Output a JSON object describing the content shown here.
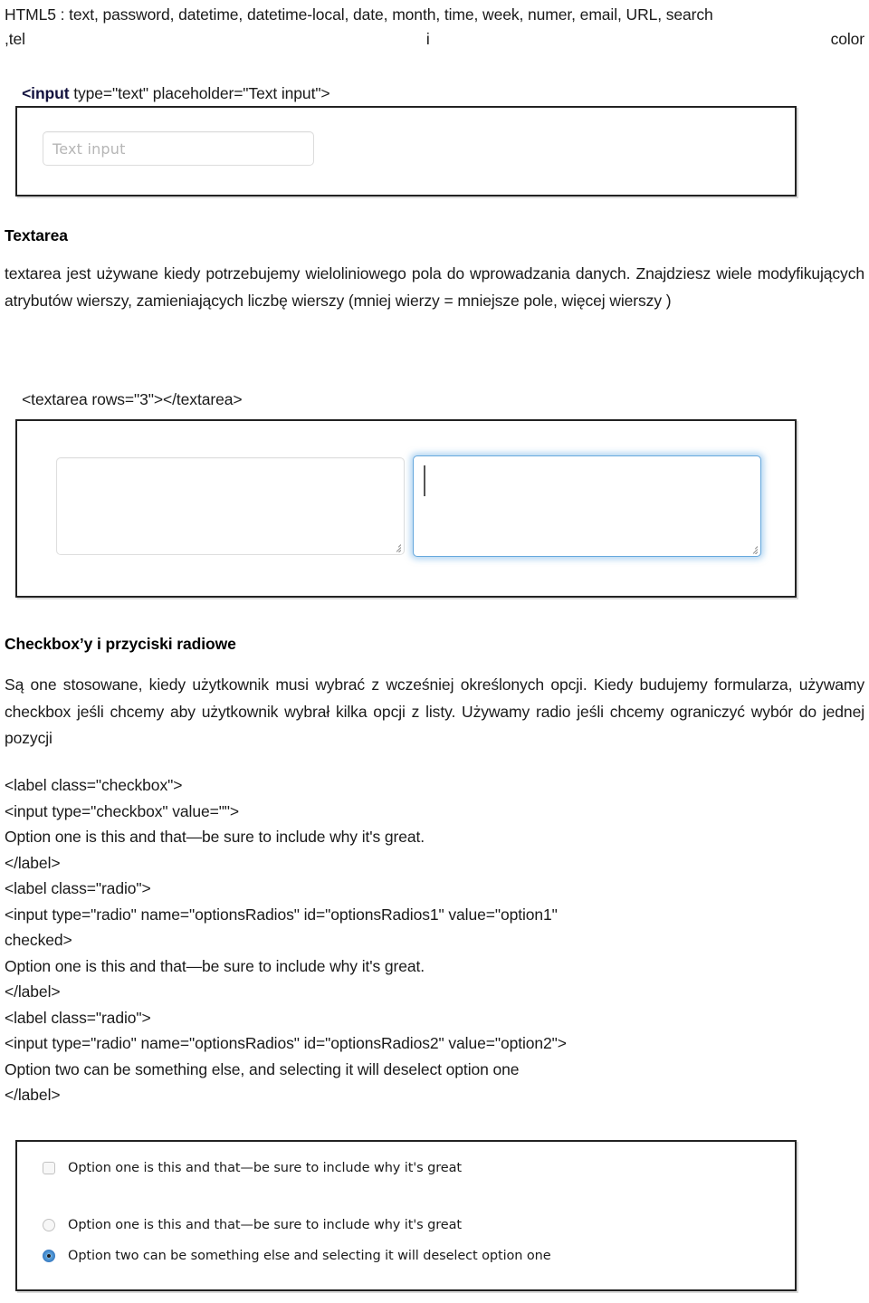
{
  "header": {
    "types_line": "HTML5 : text, password, datetime, datetime-local, date, month, time, week, numer, email, URL, search",
    "tel_left": ",tel",
    "tel_center": "i",
    "tel_right": "color",
    "input_code_bold": "<input",
    "input_code_rest": " type=\"text\" placeholder=\"Text input\">"
  },
  "text_input_figure": {
    "placeholder": "Text input"
  },
  "textarea_section": {
    "heading": "Textarea",
    "body": "textarea  jest używane kiedy potrzebujemy wieloliniowego pola do wprowadzania danych. Znajdziesz wiele modyfikujących atrybutów wierszy, zamieniających liczbę wierszy (mniej wierzy  = mniejsze pole, więcej wierszy )",
    "code": "<textarea rows=\"3\"></textarea>"
  },
  "checkbox_section": {
    "heading": "Checkbox’y i przyciski radiowe",
    "body": "Są one stosowane, kiedy użytkownik musi wybrać z wcześniej określonych opcji. Kiedy budujemy formularza, używamy checkbox jeśli chcemy aby użytkownik wybrał kilka opcji z listy. Używamy radio jeśli chcemy ograniczyć wybór do jednej pozycji",
    "code_lines": [
      "<label class=\"checkbox\">",
      "<input type=\"checkbox\" value=\"\">",
      "Option one is this and that—be sure to include why it's great.",
      "</label>",
      "<label class=\"radio\">",
      "<input type=\"radio\" name=\"optionsRadios\" id=\"optionsRadios1\" value=\"option1\"",
      "checked>",
      "Option one is this and that—be sure to include why it's great.",
      "</label>",
      "<label class=\"radio\">",
      "<input type=\"radio\" name=\"optionsRadios\" id=\"optionsRadios2\" value=\"option2\">",
      "Option two can be something else, and selecting it will deselect option one",
      "</label>"
    ]
  },
  "checkradio_figure": {
    "checkbox_label": "Option one is this and that—be sure to include why it's great",
    "radio1_label": "Option one is this and that—be sure to include why it's great",
    "radio2_label": "Option two can be something else and selecting it will deselect option one",
    "accent_color": "#3f86c8"
  }
}
